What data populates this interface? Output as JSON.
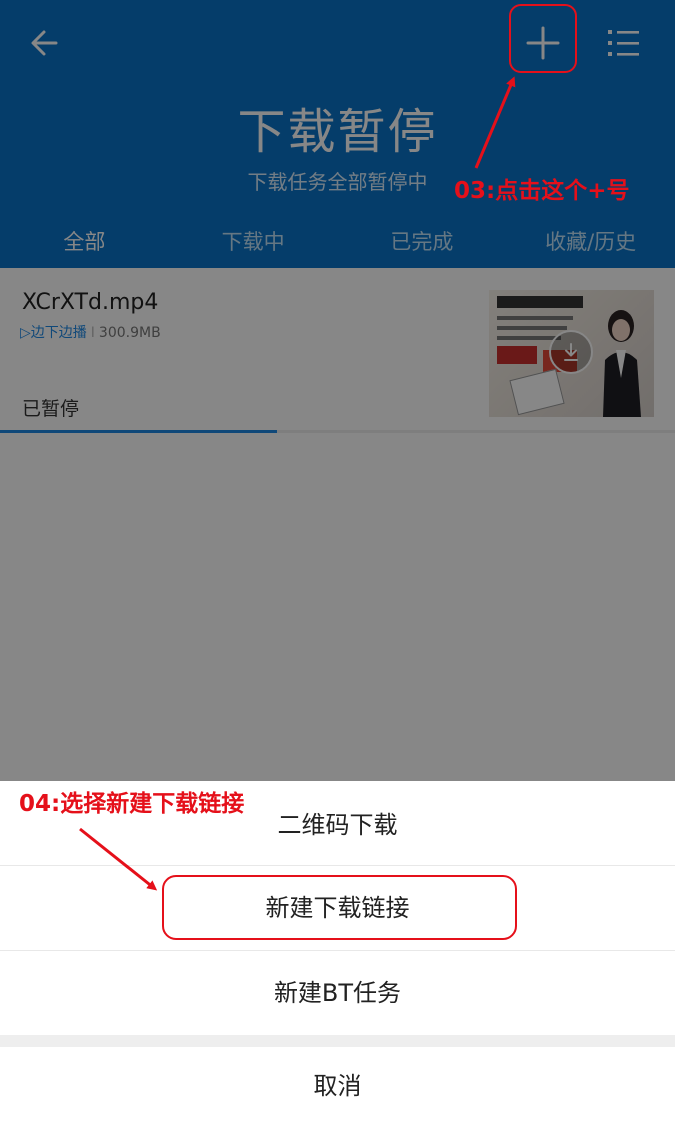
{
  "header": {
    "title": "下载暂停",
    "subtitle": "下载任务全部暂停中",
    "back_icon": "arrow-left-icon",
    "add_icon": "plus-icon",
    "menu_icon": "list-menu-icon",
    "background": "#0a74c9"
  },
  "tabs": [
    {
      "label": "全部",
      "active": true
    },
    {
      "label": "下载中",
      "active": false
    },
    {
      "label": "已完成",
      "active": false
    },
    {
      "label": "收藏/历史",
      "active": false
    }
  ],
  "task": {
    "name": "XCrXTd.mp4",
    "play_mode": "边下边播",
    "separator": "I",
    "size": "300.9MB",
    "status": "已暂停",
    "progress_fraction": 0.41,
    "thumbnail_icon": "download-icon"
  },
  "sheet": {
    "items": [
      "二维码下载",
      "新建下载链接",
      "新建BT任务"
    ],
    "cancel": "取消"
  },
  "annotations": {
    "step3": "03:点击这个+号",
    "step4": "04:选择新建下载链接",
    "color": "#e5101a"
  }
}
